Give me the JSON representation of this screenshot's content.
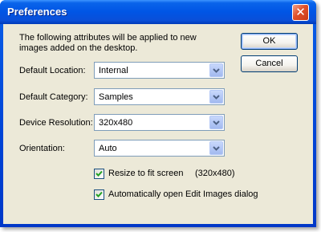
{
  "window": {
    "title": "Preferences"
  },
  "intro_text": "The following attributes will be applied to new images added on the desktop.",
  "buttons": {
    "ok": "OK",
    "cancel": "Cancel"
  },
  "fields": {
    "default_location": {
      "label": "Default Location:",
      "value": "Internal"
    },
    "default_category": {
      "label": "Default Category:",
      "value": "Samples"
    },
    "device_resolution": {
      "label": "Device Resolution:",
      "value": "320x480"
    },
    "orientation": {
      "label": "Orientation:",
      "value": "Auto"
    }
  },
  "checkboxes": {
    "resize": {
      "label": "Resize to fit screen",
      "checked": true,
      "note": "(320x480)"
    },
    "auto_open": {
      "label": "Automatically open Edit Images dialog",
      "checked": true
    }
  },
  "colors": {
    "title_bar": "#0055e5",
    "client_bg": "#ece9d8",
    "close_button": "#e0502a",
    "check_mark": "#21a121"
  },
  "icons": {
    "close": "close-icon",
    "dropdown": "chevron-down-icon",
    "check": "checkmark-icon"
  }
}
